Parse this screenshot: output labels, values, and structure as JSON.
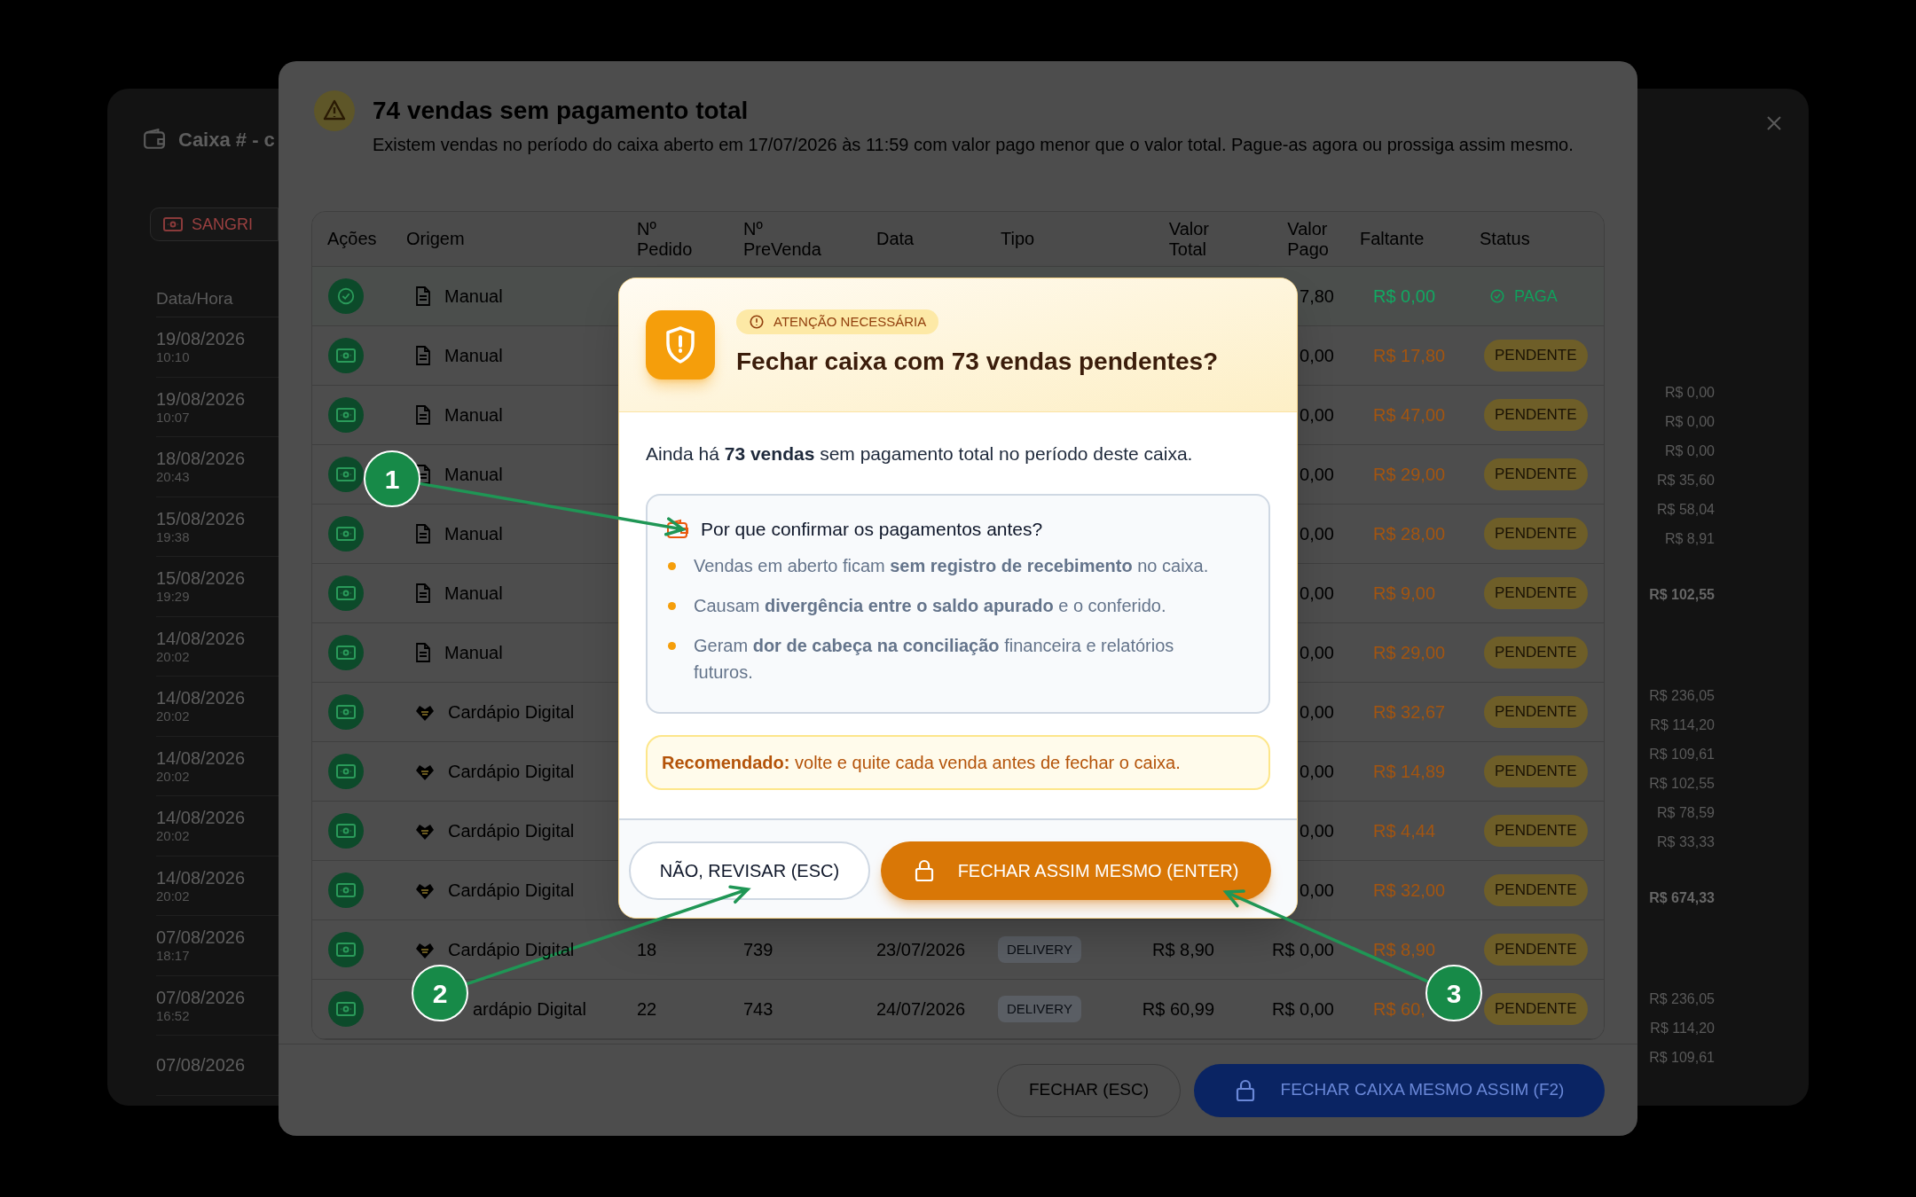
{
  "background_panel": {
    "title": "Caixa # - c",
    "sangria_button": "SANGRI",
    "date_column": "Data/Hora",
    "dates": [
      {
        "date": "19/08/2026",
        "time": "10:10"
      },
      {
        "date": "19/08/2026",
        "time": "10:07"
      },
      {
        "date": "18/08/2026",
        "time": "20:43"
      },
      {
        "date": "15/08/2026",
        "time": "19:38"
      },
      {
        "date": "15/08/2026",
        "time": "19:29"
      },
      {
        "date": "14/08/2026",
        "time": "20:02"
      },
      {
        "date": "14/08/2026",
        "time": "20:02"
      },
      {
        "date": "14/08/2026",
        "time": "20:02"
      },
      {
        "date": "14/08/2026",
        "time": "20:02"
      },
      {
        "date": "14/08/2026",
        "time": "20:02"
      },
      {
        "date": "07/08/2026",
        "time": "18:17"
      },
      {
        "date": "07/08/2026",
        "time": "16:52"
      },
      {
        "date": "07/08/2026"
      }
    ],
    "amount_groups": [
      {
        "amounts": [
          "R$ 0,00",
          "R$ 0,00",
          "R$ 0,00",
          "R$ 35,60",
          "R$ 58,04",
          "R$ 8,91"
        ],
        "total": "R$ 102,55"
      },
      {
        "amounts": [
          "R$ 236,05",
          "R$ 114,20",
          "R$ 109,61",
          "R$ 102,55",
          "R$ 78,59",
          "R$ 33,33"
        ],
        "total": "R$ 674,33"
      },
      {
        "amounts": [
          "R$ 236,05",
          "R$ 114,20",
          "R$ 109,61"
        ]
      }
    ]
  },
  "sales_dialog": {
    "title": "74 vendas sem pagamento total",
    "description": "Existem vendas no período do caixa aberto em 17/07/2026 às 11:59 com valor pago menor que o valor total. Pague-as agora ou prossiga assim mesmo.",
    "columns": [
      "Ações",
      "Origem",
      "Nº Pedido",
      "Nº PreVenda",
      "Data",
      "Tipo",
      "Valor Total",
      "Valor Pago",
      "Faltante",
      "Status"
    ],
    "rows": [
      {
        "action": {
          "kind": "check"
        },
        "origin": {
          "kind": "manual",
          "text": "Manual"
        },
        "valor_pago": "7,80",
        "faltante": "R$ 0,00",
        "status": {
          "kind": "paid",
          "text": "PAGA"
        }
      },
      {
        "action": {
          "kind": "cash"
        },
        "origin": {
          "kind": "manual",
          "text": "Manual"
        },
        "valor_pago": "0,00",
        "faltante": "R$ 17,80",
        "status": {
          "kind": "pending",
          "text": "PENDENTE"
        }
      },
      {
        "action": {
          "kind": "cash"
        },
        "origin": {
          "kind": "manual",
          "text": "Manual"
        },
        "valor_pago": "0,00",
        "faltante": "R$ 47,00",
        "status": {
          "kind": "pending",
          "text": "PENDENTE"
        }
      },
      {
        "action": {
          "kind": "cash"
        },
        "origin": {
          "kind": "manual",
          "text": "Manual"
        },
        "valor_pago": "0,00",
        "faltante": "R$ 29,00",
        "status": {
          "kind": "pending",
          "text": "PENDENTE"
        }
      },
      {
        "action": {
          "kind": "cash"
        },
        "origin": {
          "kind": "manual",
          "text": "Manual"
        },
        "valor_pago": "0,00",
        "faltante": "R$ 28,00",
        "status": {
          "kind": "pending",
          "text": "PENDENTE"
        }
      },
      {
        "action": {
          "kind": "cash"
        },
        "origin": {
          "kind": "manual",
          "text": "Manual"
        },
        "valor_pago": "0,00",
        "faltante": "R$ 9,00",
        "status": {
          "kind": "pending",
          "text": "PENDENTE"
        }
      },
      {
        "action": {
          "kind": "cash"
        },
        "origin": {
          "kind": "manual",
          "text": "Manual"
        },
        "valor_pago": "0,00",
        "faltante": "R$ 29,00",
        "status": {
          "kind": "pending",
          "text": "PENDENTE"
        }
      },
      {
        "action": {
          "kind": "cash"
        },
        "origin": {
          "kind": "digital",
          "text": "Cardápio Digital"
        },
        "valor_pago": "0,00",
        "faltante": "R$ 32,67",
        "status": {
          "kind": "pending",
          "text": "PENDENTE"
        }
      },
      {
        "action": {
          "kind": "cash"
        },
        "origin": {
          "kind": "digital",
          "text": "Cardápio Digital"
        },
        "valor_pago": "0,00",
        "faltante": "R$ 14,89",
        "status": {
          "kind": "pending",
          "text": "PENDENTE"
        }
      },
      {
        "action": {
          "kind": "cash"
        },
        "origin": {
          "kind": "digital",
          "text": "Cardápio Digital"
        },
        "valor_pago": "0,00",
        "faltante": "R$ 4,44",
        "status": {
          "kind": "pending",
          "text": "PENDENTE"
        }
      },
      {
        "action": {
          "kind": "cash"
        },
        "origin": {
          "kind": "digital",
          "text": "Cardápio Digital"
        },
        "valor_pago": "0,00",
        "faltante": "R$ 32,00",
        "status": {
          "kind": "pending",
          "text": "PENDENTE"
        }
      },
      {
        "action": {
          "kind": "cash"
        },
        "origin": {
          "kind": "digital",
          "text": "Cardápio Digital"
        },
        "pedido": "18",
        "prevenda": "739",
        "data": "23/07/2026",
        "tipo": "DELIVERY",
        "valor_total": "R$ 8,90",
        "valor_pago": "R$ 0,00",
        "faltante": "R$ 8,90",
        "status": {
          "kind": "pending",
          "text": "PENDENTE"
        }
      },
      {
        "action": {
          "kind": "cash"
        },
        "origin": {
          "kind": "hidden",
          "text": "ardápio Digital"
        },
        "pedido": "22",
        "prevenda": "743",
        "data": "24/07/2026",
        "tipo": "DELIVERY",
        "valor_total": "R$ 60,99",
        "valor_pago": "R$ 0,00",
        "faltante": "R$ 60,",
        "status": {
          "kind": "pending",
          "text": "PENDENTE"
        }
      }
    ],
    "buttons": [
      {
        "label": "FECHAR (ESC)",
        "kind": "outline"
      },
      {
        "label": "FECHAR CAIXA MESMO ASSIM (F2)",
        "kind": "primary"
      }
    ]
  },
  "confirm_modal": {
    "badge": "ATENÇÃO NECESSÁRIA",
    "title": "Fechar caixa com 73 vendas pendentes?",
    "intro": "Ainda há **73 vendas** sem pagamento total no período deste caixa.",
    "info_title": "Por que confirmar os pagamentos antes?",
    "reasons": [
      "Vendas em aberto ficam **sem registro de recebimento** no caixa.",
      "Causam **divergência entre o saldo apurado** e o conferido.",
      "Geram **dor de cabeça na conciliação** financeira e relatórios futuros."
    ],
    "recommendation": "**Recomendado:** volte e quite cada venda antes de fechar o caixa.",
    "buttons": [
      {
        "label": "NÃO, REVISAR (ESC)",
        "kind": "outline"
      },
      {
        "label": "FECHAR ASSIM MESMO (ENTER)",
        "kind": "primary"
      }
    ]
  },
  "annotations": [
    {
      "label": "1"
    },
    {
      "label": "2"
    },
    {
      "label": "3"
    }
  ]
}
